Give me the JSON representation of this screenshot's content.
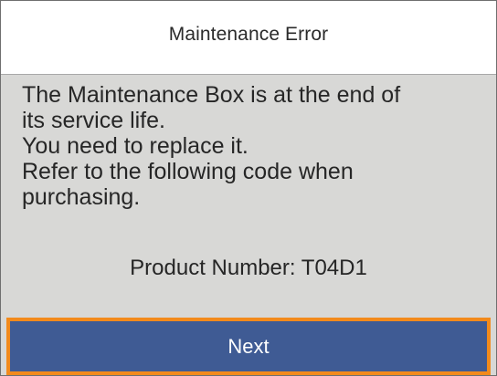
{
  "header": {
    "title": "Maintenance Error"
  },
  "message": {
    "lines": [
      "The Maintenance Box is at the end of",
      "its service life.",
      "You need to replace it.",
      "Refer to the following code when",
      "purchasing."
    ],
    "product_number": "Product Number: T04D1"
  },
  "footer": {
    "next_label": "Next"
  },
  "colors": {
    "panel_background": "#d8d8d6",
    "button_background": "#3f5b94",
    "button_focus_border": "#f28a1c"
  }
}
